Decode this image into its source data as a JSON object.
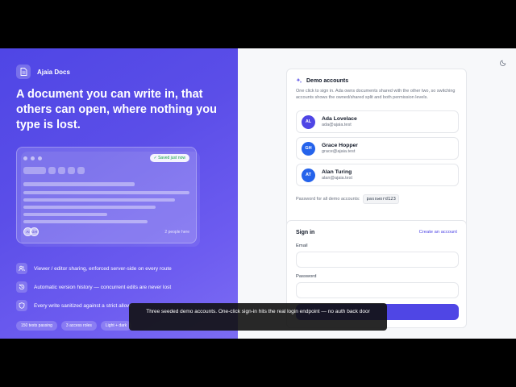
{
  "brand": {
    "name": "Ajaia Docs",
    "icon": "document-icon"
  },
  "headline": "A document you can write in, that others can open, where nothing you type is lost.",
  "preview": {
    "saved_badge": "✓ Saved just now",
    "avatars": [
      "AI",
      "GH"
    ],
    "people": "2 people here"
  },
  "features": [
    {
      "icon": "users-icon",
      "text": "Viewer / editor sharing, enforced server-side on every route"
    },
    {
      "icon": "history-icon",
      "text": "Automatic version history — concurrent edits are never lost"
    },
    {
      "icon": "shield-icon",
      "text": "Every write sanitized against a strict allow"
    }
  ],
  "chips": [
    "150 tests passing",
    "3 access roles",
    "Light + dark"
  ],
  "demo": {
    "title": "Demo accounts",
    "description": "One click to sign in. Ada owns documents shared with the other two, so switching accounts shows the owned/shared split and both permission levels.",
    "accounts": [
      {
        "initials": "AL",
        "name": "Ada Lovelace",
        "email": "ada@ajaia.test",
        "color": "#4f46e5"
      },
      {
        "initials": "GH",
        "name": "Grace Hopper",
        "email": "grace@ajaia.test",
        "color": "#2563eb"
      },
      {
        "initials": "AT",
        "name": "Alan Turing",
        "email": "alan@ajaia.test",
        "color": "#2563eb"
      }
    ],
    "password_label": "Password for all demo accounts:",
    "password": "password123"
  },
  "signin": {
    "title": "Sign in",
    "create_link": "Create an account",
    "email_label": "Email",
    "password_label": "Password"
  },
  "caption": "Three seeded demo accounts. One-click sign-in hits the real login endpoint — no auth back door",
  "colors": {
    "accent": "#4f46e5",
    "left_panel_start": "#4f46e5",
    "left_panel_end": "#7c6cf3"
  }
}
